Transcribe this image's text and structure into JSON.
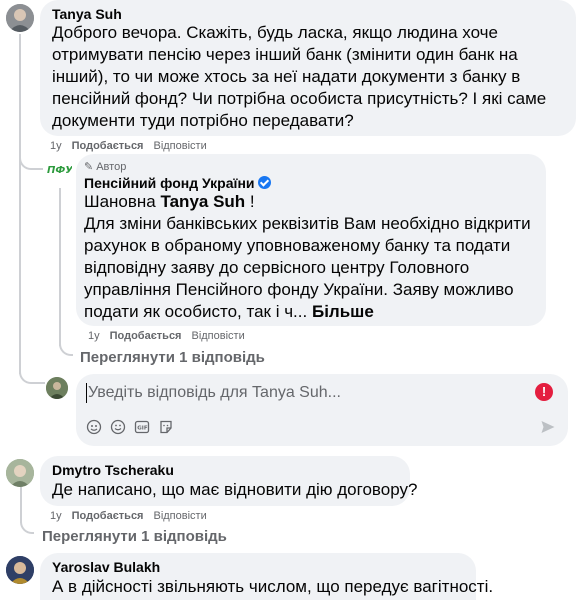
{
  "comments": [
    {
      "author": "Tanya Suh",
      "text": "Доброго вечора. Скажіть, будь ласка, якщо людина хоче отримувати пенсію через інший банк (змінити один банк на інший), то чи може хтось за неї надати документи з банку в пенсійний фонд? Чи потрібна особиста присутність? І які саме документи туди потрібно передавати?",
      "time": "1y",
      "like": "Подобається",
      "reply": "Відповісти"
    },
    {
      "author_badge": "Автор",
      "author": "Пенсійний фонд України",
      "greeting_prefix": "Шановна ",
      "greeting_name": "Tanya Suh",
      "greeting_suffix": " !",
      "text": "Для зміни банківських реквізитів Вам необхідно відкрити рахунок в обраному уповноваженому банку та подати відповідну заяву до сервісного центру Головного управління Пенсійного фонду України. Заяву можливо подати як особисто, так і ч...",
      "more": "Більше",
      "time": "1y",
      "like": "Подобається",
      "reply": "Відповісти",
      "logo_text": "ПФУ"
    },
    {
      "author": "Dmytro Tscheraku",
      "text": "Де написано, що має відновити дію договору?",
      "time": "1y",
      "like": "Подобається",
      "reply": "Відповісти"
    },
    {
      "author": "Yaroslav Bulakh",
      "text": "А в дійсності звільняють числом, що передує вагітності."
    }
  ],
  "view_replies_1": "Переглянути 1 відповідь",
  "view_replies_2": "Переглянути 1 відповідь",
  "reply_box": {
    "placeholder": "Уведіть відповідь для Tanya Suh...",
    "tools": [
      "emoji-smile-icon",
      "emoji-icon",
      "gif-icon",
      "sticker-icon"
    ]
  },
  "colors": {
    "bubble": "#f0f2f5",
    "muted": "#65676b",
    "verified": "#1877f2",
    "alert": "#e41e3f",
    "pfu_green": "#2e9b3e"
  }
}
